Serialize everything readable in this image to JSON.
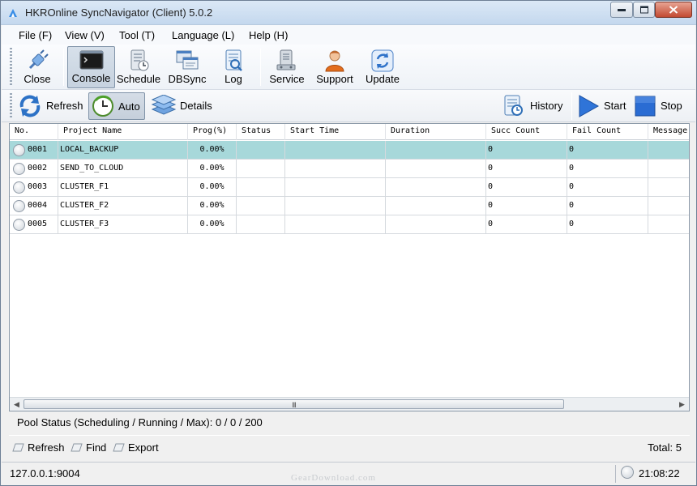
{
  "window": {
    "title": "HKROnline SyncNavigator (Client) 5.0.2"
  },
  "menu": [
    "File (F)",
    "View (V)",
    "Tool (T)",
    "Language (L)",
    "Help (H)"
  ],
  "toolbar1": {
    "close": "Close",
    "console": "Console",
    "schedule": "Schedule",
    "dbsync": "DBSync",
    "log": "Log",
    "service": "Service",
    "support": "Support",
    "update": "Update"
  },
  "toolbar2": {
    "refresh": "Refresh",
    "auto": "Auto",
    "details": "Details",
    "history": "History",
    "start": "Start",
    "stop": "Stop"
  },
  "grid": {
    "columns": [
      "No.",
      "Project Name",
      "Prog(%)",
      "Status",
      "Start Time",
      "Duration",
      "Succ Count",
      "Fail Count",
      "Message"
    ],
    "rows": [
      {
        "no": "0001",
        "name": "LOCAL_BACKUP",
        "prog": "0.00%",
        "status": "",
        "start": "",
        "duration": "",
        "succ": "0",
        "fail": "0",
        "message": ""
      },
      {
        "no": "0002",
        "name": "SEND_TO_CLOUD",
        "prog": "0.00%",
        "status": "",
        "start": "",
        "duration": "",
        "succ": "0",
        "fail": "0",
        "message": ""
      },
      {
        "no": "0003",
        "name": "CLUSTER_F1",
        "prog": "0.00%",
        "status": "",
        "start": "",
        "duration": "",
        "succ": "0",
        "fail": "0",
        "message": ""
      },
      {
        "no": "0004",
        "name": "CLUSTER_F2",
        "prog": "0.00%",
        "status": "",
        "start": "",
        "duration": "",
        "succ": "0",
        "fail": "0",
        "message": ""
      },
      {
        "no": "0005",
        "name": "CLUSTER_F3",
        "prog": "0.00%",
        "status": "",
        "start": "",
        "duration": "",
        "succ": "0",
        "fail": "0",
        "message": ""
      }
    ],
    "scroll_grip": "III"
  },
  "pool_status": "Pool Status (Scheduling / Running / Max):  0 / 0 / 200",
  "bottom_actions": {
    "refresh": "Refresh",
    "find": "Find",
    "export": "Export"
  },
  "total": "Total: 5",
  "statusbar": {
    "address": "127.0.0.1:9004",
    "time": "21:08:22"
  },
  "watermark": "GearDownload.com",
  "colors": {
    "selected_row": "#a7d8da",
    "accent_blue": "#2f6fd6"
  }
}
